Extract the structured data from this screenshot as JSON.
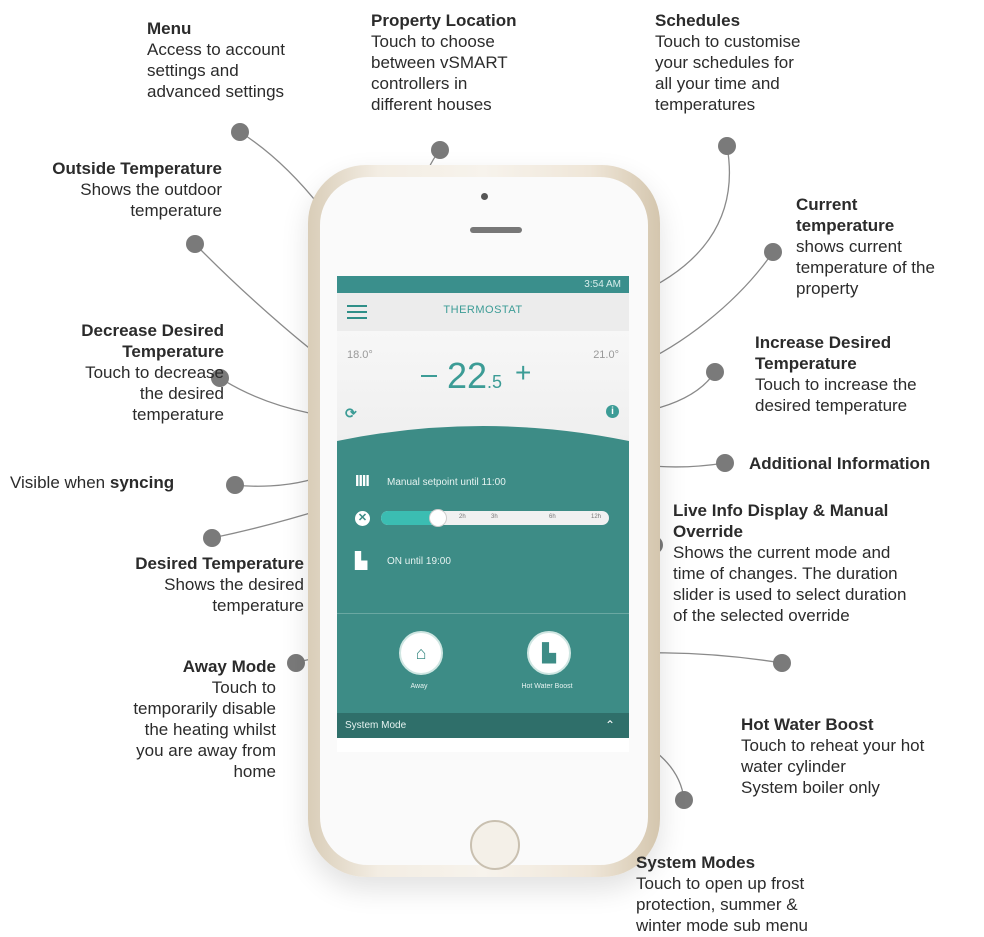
{
  "annotations": {
    "menu": {
      "title": "Menu",
      "desc": [
        "Access to account",
        "settings and",
        "advanced settings"
      ]
    },
    "property": {
      "title": "Property Location",
      "desc": [
        "Touch to choose",
        "between vSMART",
        "controllers in",
        "different houses"
      ]
    },
    "schedules": {
      "title": "Schedules",
      "desc": [
        "Touch to customise",
        "your schedules for",
        "all your time and",
        "temperatures"
      ]
    },
    "outside": {
      "title": "Outside Temperature",
      "desc": [
        "Shows the outdoor",
        "temperature"
      ]
    },
    "current": {
      "title": [
        "Current",
        "temperature"
      ],
      "desc": [
        "shows current",
        "temperature of the",
        "property"
      ]
    },
    "decrease": {
      "title": [
        "Decrease Desired",
        "Temperature"
      ],
      "desc": [
        "Touch to decrease",
        "the desired",
        "temperature"
      ]
    },
    "increase": {
      "title": [
        "Increase Desired",
        "Temperature"
      ],
      "desc": [
        "Touch to increase the",
        "desired temperature"
      ]
    },
    "syncing": {
      "prefix": "Visible when ",
      "bold": "syncing"
    },
    "additional": {
      "title": "Additional Information"
    },
    "desired": {
      "title": "Desired Temperature",
      "desc": [
        "Shows the desired",
        "temperature"
      ]
    },
    "live": {
      "title": [
        "Live Info Display & Manual",
        "Override"
      ],
      "desc": [
        "Shows the current mode and",
        "time of changes. The duration",
        "slider is used to select duration",
        "of the selected override"
      ]
    },
    "away": {
      "title": "Away Mode",
      "desc": [
        "Touch to",
        "temporarily disable",
        "the heating whilst",
        "you are away from",
        "home"
      ]
    },
    "hotwater": {
      "title": "Hot Water Boost",
      "desc": [
        "Touch to reheat your hot",
        "water cylinder",
        "System boiler only"
      ]
    },
    "sysmodes": {
      "title": "System Modes",
      "desc": [
        "Touch to open up frost",
        "protection, summer &",
        "winter mode sub menu"
      ]
    }
  },
  "app": {
    "status_time": "3:54 AM",
    "title": "THERMOSTAT",
    "outside_temp": "18.0°",
    "current_temp": "21.0°",
    "desired_main": "22",
    "desired_dec": ".5",
    "manual_line": "Manual setpoint until 11:00",
    "slider_ticks": [
      "2h",
      "3h",
      "6h",
      "12h"
    ],
    "hot_water_line": "ON until 19:00",
    "away_label": "Away",
    "hotwater_label": "Hot Water Boost",
    "system_mode": "System Mode"
  },
  "colors": {
    "teal": "#3d8c86",
    "accent": "#3c9c96"
  },
  "icons": [
    "hamburger-icon",
    "sync-icon",
    "info-icon",
    "radiator-icon",
    "close-icon",
    "tap-icon",
    "away-icon",
    "hot-water-icon",
    "chevron-up-icon"
  ]
}
